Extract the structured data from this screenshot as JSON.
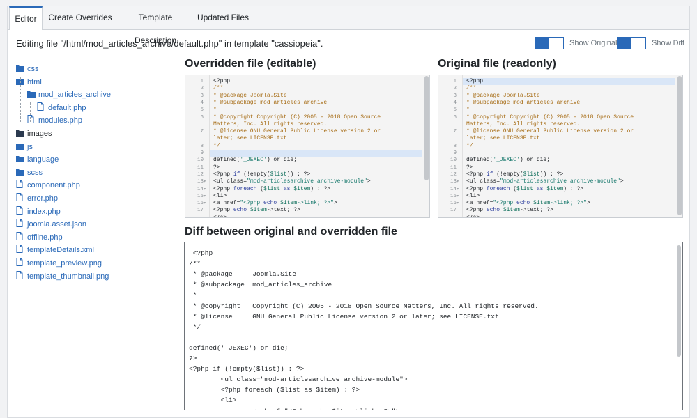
{
  "tabs": [
    {
      "label": "Editor",
      "active": true
    },
    {
      "label": "Create Overrides",
      "active": false
    },
    {
      "label": "Template Description",
      "active": false
    },
    {
      "label": "Updated Files",
      "active": false
    }
  ],
  "editing_text": "Editing file \"/html/mod_articles_archive/default.php\" in template \"cassiopeia\".",
  "toggles": {
    "show_original": "Show Original",
    "show_diff": "Show Diff"
  },
  "accent_color": "#2a69b8",
  "file_tree": [
    {
      "label": "css",
      "type": "folder"
    },
    {
      "label": "html",
      "type": "folder"
    },
    {
      "label": "mod_articles_archive",
      "type": "folder"
    },
    {
      "label": "default.php",
      "type": "file"
    },
    {
      "label": "modules.php",
      "type": "file"
    },
    {
      "label": "images",
      "type": "folder"
    },
    {
      "label": "js",
      "type": "folder"
    },
    {
      "label": "language",
      "type": "folder"
    },
    {
      "label": "scss",
      "type": "folder"
    },
    {
      "label": "component.php",
      "type": "file"
    },
    {
      "label": "error.php",
      "type": "file"
    },
    {
      "label": "index.php",
      "type": "file"
    },
    {
      "label": "joomla.asset.json",
      "type": "file"
    },
    {
      "label": "offline.php",
      "type": "file"
    },
    {
      "label": "templateDetails.xml",
      "type": "file"
    },
    {
      "label": "template_preview.png",
      "type": "file"
    },
    {
      "label": "template_thumbnail.png",
      "type": "file"
    }
  ],
  "overridden_title": "Overridden file (editable)",
  "original_title": "Original file (readonly)",
  "diff_title": "Diff between original and overridden file",
  "code_lines": [
    {
      "n": "1",
      "text": "<?php"
    },
    {
      "n": "2",
      "text": "/**"
    },
    {
      "n": "3",
      "text": " * @package     Joomla.Site"
    },
    {
      "n": "4",
      "text": " * @subpackage  mod_articles_archive"
    },
    {
      "n": "5",
      "text": " *"
    },
    {
      "n": "6",
      "text": " * @copyright   Copyright (C) 2005 - 2018 Open Source"
    },
    {
      "n": "",
      "text": "Matters, Inc. All rights reserved."
    },
    {
      "n": "7",
      "text": " * @license     GNU General Public License version 2 or"
    },
    {
      "n": "",
      "text": "later; see LICENSE.txt"
    },
    {
      "n": "8",
      "text": " */"
    },
    {
      "n": "9",
      "text": ""
    },
    {
      "n": "10",
      "text": "defined('_JEXEC') or die;"
    },
    {
      "n": "11",
      "text": "?>"
    },
    {
      "n": "12",
      "text": "<?php if (!empty($list)) : ?>"
    },
    {
      "n": "13",
      "text": "    <ul class=\"mod-articlesarchive archive-module\">"
    },
    {
      "n": "14",
      "text": "    <?php foreach ($list as $item) : ?>"
    },
    {
      "n": "15",
      "text": "    <li>"
    },
    {
      "n": "16",
      "text": "        <a href=\"<?php echo $item->link; ?>\">"
    },
    {
      "n": "17",
      "text": "            <?php echo $item->text; ?>"
    },
    {
      "n": "",
      "text": "        </a>"
    }
  ],
  "diff_lines": [
    " <?php",
    "/**",
    " * @package     Joomla.Site",
    " * @subpackage  mod_articles_archive",
    " *",
    " * @copyright   Copyright (C) 2005 - 2018 Open Source Matters, Inc. All rights reserved.",
    " * @license     GNU General Public License version 2 or later; see LICENSE.txt",
    " */",
    "",
    "defined('_JEXEC') or die;",
    "?>",
    "<?php if (!empty($list)) : ?>",
    "        <ul class=\"mod-articlesarchive archive-module\">",
    "        <?php foreach ($list as $item) : ?>",
    "        <li>",
    "                <a href=\"<?php echo $item->link; ?>\">"
  ]
}
